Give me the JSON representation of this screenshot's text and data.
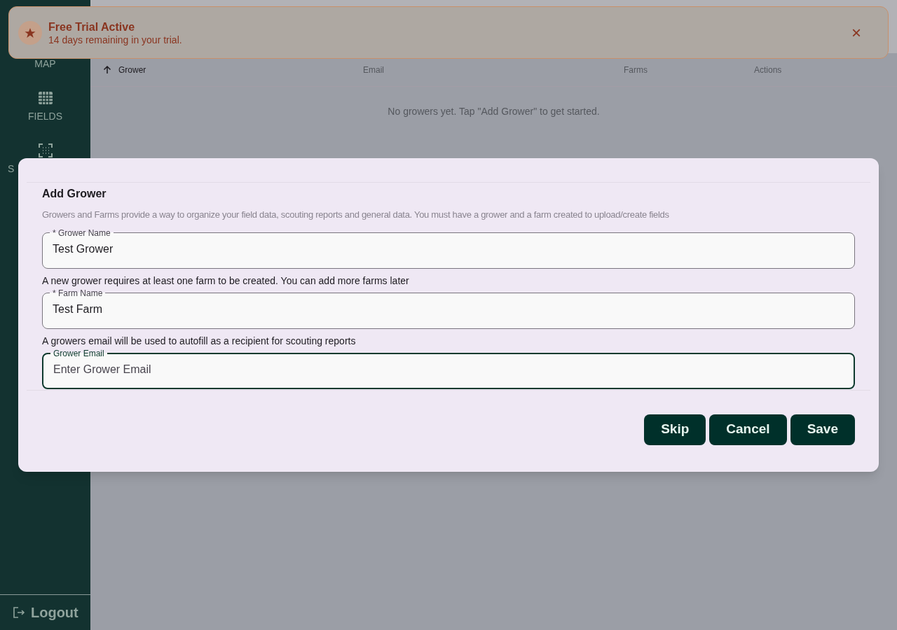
{
  "sidebar": {
    "items": [
      {
        "label": "MAP"
      },
      {
        "label": "FIELDS"
      },
      {
        "label": "S"
      }
    ],
    "logout": "Logout"
  },
  "banner": {
    "title": "Free Trial Active",
    "message": "14 days remaining in your trial.",
    "close": "×"
  },
  "table": {
    "columns": [
      {
        "label": "Grower",
        "sorted": true
      },
      {
        "label": "Email",
        "sorted": false
      },
      {
        "label": "Farms",
        "sorted": false
      },
      {
        "label": "Actions",
        "sorted": false
      }
    ],
    "empty_message": "No growers yet. Tap \"Add Grower\" to get started."
  },
  "dialog": {
    "title": "Add Grower",
    "description": "Growers and Farms provide a way to organize your field data, scouting reports and general data. You must have a grower and a farm created to upload/create fields",
    "fields": [
      {
        "label": "* Grower Name",
        "value": "Test Grower",
        "focused": false
      },
      {
        "help": "A new grower requires at least one farm to be created. You can add more farms later",
        "label": "* Farm Name",
        "value": "Test Farm",
        "focused": false
      },
      {
        "help": "A growers email will be used to autofill as a recipient for scouting reports",
        "label": "Grower Email",
        "placeholder": "Enter Grower Email",
        "focused": true
      }
    ],
    "buttons": [
      "Skip",
      "Cancel",
      "Save"
    ]
  }
}
